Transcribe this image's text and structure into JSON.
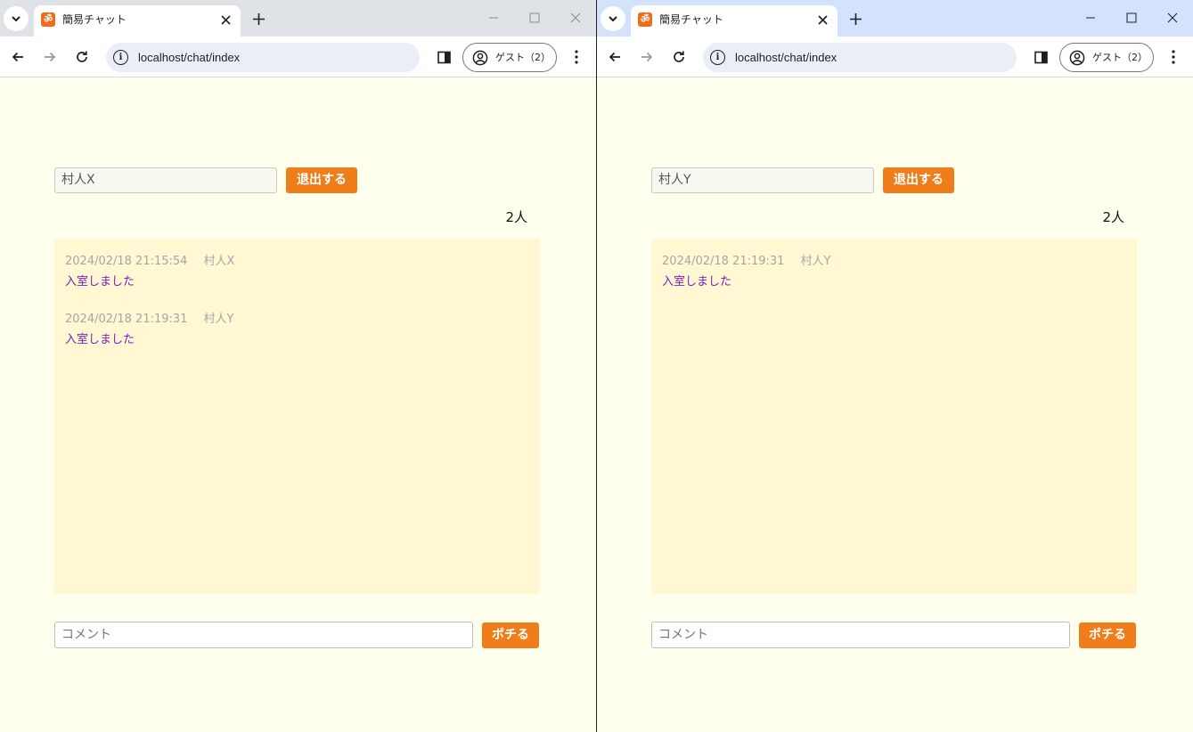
{
  "windows": [
    {
      "tab_title": "簡易チャット",
      "favicon_glyph": "ॐ",
      "url": "localhost/chat/index",
      "profile_label": "ゲスト（2）",
      "name_value": "村人X",
      "leave_label": "退出する",
      "count_label": "2人",
      "comment_placeholder": "コメント",
      "post_label": "ポチる",
      "messages": [
        {
          "timestamp": "2024/02/18 21:15:54",
          "author": "村人X",
          "text": "入室しました"
        },
        {
          "timestamp": "2024/02/18 21:19:31",
          "author": "村人Y",
          "text": "入室しました"
        }
      ]
    },
    {
      "tab_title": "簡易チャット",
      "favicon_glyph": "ॐ",
      "url": "localhost/chat/index",
      "profile_label": "ゲスト（2）",
      "name_value": "村人Y",
      "leave_label": "退出する",
      "count_label": "2人",
      "comment_placeholder": "コメント",
      "post_label": "ポチる",
      "messages": [
        {
          "timestamp": "2024/02/18 21:19:31",
          "author": "村人Y",
          "text": "入室しました"
        }
      ]
    }
  ],
  "colors": {
    "page_bg": "#ffffee",
    "chat_bg": "#fff8d2",
    "accent": "#ef7d1a",
    "message_text": "#7a1fb8",
    "meta_text": "#a6a6a6",
    "left_titlebar": "#dfe2e7",
    "right_titlebar": "#d3e3fd"
  },
  "icons": [
    "tab-search-icon",
    "favicon-icon",
    "close-icon",
    "plus-icon",
    "minimize-icon",
    "maximize-icon",
    "back-icon",
    "forward-icon",
    "reload-icon",
    "info-icon",
    "side-panel-icon",
    "profile-icon",
    "more-menu-icon"
  ]
}
